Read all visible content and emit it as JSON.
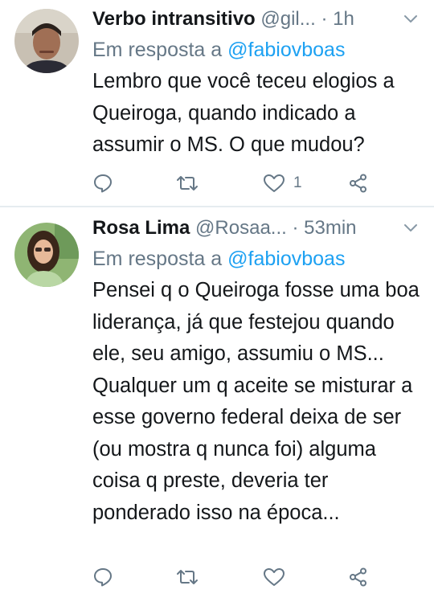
{
  "tweets": [
    {
      "author_name": "Verbo intransitivo",
      "handle": "@gil...",
      "separator": "·",
      "time": "1h",
      "reply_prefix": "Em resposta a ",
      "reply_to": "@fabiovboas",
      "text": "Lembro que você teceu elogios a Queiroga, quando indicado a assumir o MS. O que mudou?",
      "like_count": "1"
    },
    {
      "author_name": "Rosa Lima",
      "handle": "@Rosaa...",
      "separator": "·",
      "time": "53min",
      "reply_prefix": "Em resposta a ",
      "reply_to": "@fabiovboas",
      "text": "Pensei q o Queiroga fosse uma boa liderança, já que festejou quando ele, seu amigo, assumiu o MS... Qualquer um q aceite se misturar a esse governo federal deixa de ser (ou mostra q nunca foi) alguma coisa q preste, deveria ter ponderado isso na época...",
      "like_count": ""
    }
  ],
  "icons": {
    "reply": "reply-icon",
    "retweet": "retweet-icon",
    "like": "heart-icon",
    "share": "share-icon",
    "menu": "chevron-down-icon"
  },
  "colors": {
    "text": "#14171a",
    "secondary": "#657786",
    "link": "#1da1f2",
    "divider": "#e6ecf0"
  }
}
